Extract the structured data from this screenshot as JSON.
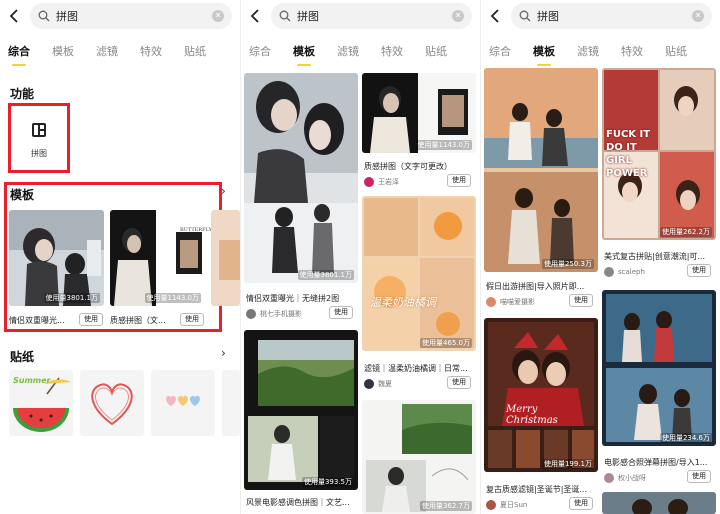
{
  "search": {
    "query": "拼图"
  },
  "screens": [
    {
      "tabs": [
        "综合",
        "模板",
        "滤镜",
        "特效",
        "贴纸"
      ],
      "active_tab": "综合",
      "function_section": {
        "title": "功能",
        "item_label": "拼图"
      },
      "template_section": {
        "title": "模板",
        "cards": [
          {
            "caption": "情侣双重曝光...",
            "usage": "使用量3801.1万",
            "button": "使用"
          },
          {
            "caption": "质感拼图（文...",
            "usage": "使用量1143.0万",
            "button": "使用"
          }
        ],
        "partial_card_text": "BUTTERFLY"
      },
      "sticker_section": {
        "title": "贴纸",
        "stickers": [
          "watermelon-sticker",
          "heart-sticker",
          "mini-hearts-sticker",
          "pink-sticker"
        ],
        "watermelon_text": "Summer"
      }
    },
    {
      "tabs": [
        "综合",
        "模板",
        "滤镜",
        "特效",
        "贴纸"
      ],
      "active_tab": "模板",
      "cards": [
        {
          "title": "情侣双重曝光｜无缝拼2图",
          "usage": "使用量3801.1万",
          "author": "桃七手机摄影",
          "button": "使用"
        },
        {
          "title": "风景电影感调色拼图｜文艺...",
          "usage": "使用量393.5万",
          "author": "",
          "button": "使用"
        },
        {
          "title": "质感拼图（文字可更改）",
          "usage": "使用量1143.0万",
          "author": "王岩泽",
          "button": "使用"
        },
        {
          "title": "滤镜｜温柔奶油橘调｜日常...",
          "usage": "使用量465.0万",
          "author": "魏夏",
          "button": "使用",
          "overlay": "温柔奶油橘调"
        },
        {
          "title": "",
          "usage": "使用量362.7万",
          "author": "",
          "button": ""
        }
      ]
    },
    {
      "tabs": [
        "综合",
        "模板",
        "滤镜",
        "特效",
        "贴纸"
      ],
      "active_tab": "模板",
      "cards": [
        {
          "title": "假日出游拼图|导入照片即...",
          "usage": "使用量250.3万",
          "author": "喵喵爱摄影",
          "button": "使用"
        },
        {
          "title": "复古质感滤镜|圣诞节|圣诞...",
          "usage": "使用量199.1万",
          "author": "夏日Sun",
          "button": "使用",
          "overlay": "Merry Christmas"
        },
        {
          "title": "美式复古拼贴|创意潮流|可...",
          "usage": "使用量262.2万",
          "author": "scaleph",
          "button": "使用",
          "overlay": "FUCK IT DO IT GIRL POWER"
        },
        {
          "title": "电影感合照弹幕拼图/导入1...",
          "usage": "使用量234.6万",
          "author": "权小战呀",
          "button": "使用"
        }
      ]
    }
  ]
}
